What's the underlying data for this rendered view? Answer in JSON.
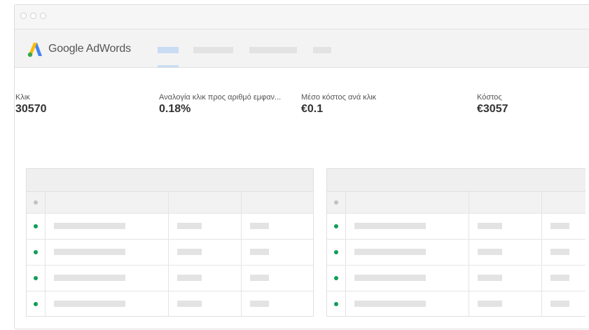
{
  "app": {
    "brand": "Google AdWords",
    "colors": {
      "logo_blue": "#4285f4",
      "logo_yellow": "#fbbc04",
      "logo_green": "#34a853",
      "status_green": "#0f9d58",
      "active_tab": "#c9dcf3"
    }
  },
  "metrics": [
    {
      "label": "Κλικ",
      "value": "30570"
    },
    {
      "label": "Αναλογία κλικ προς αριθμό εμφαν...",
      "value": "0.18%"
    },
    {
      "label": "Μέσο κόστος ανά κλικ",
      "value": "€0.1"
    },
    {
      "label": "Κόστος",
      "value": "€3057"
    }
  ],
  "tables": {
    "row_status": [
      "enabled",
      "enabled",
      "enabled",
      "enabled"
    ]
  }
}
